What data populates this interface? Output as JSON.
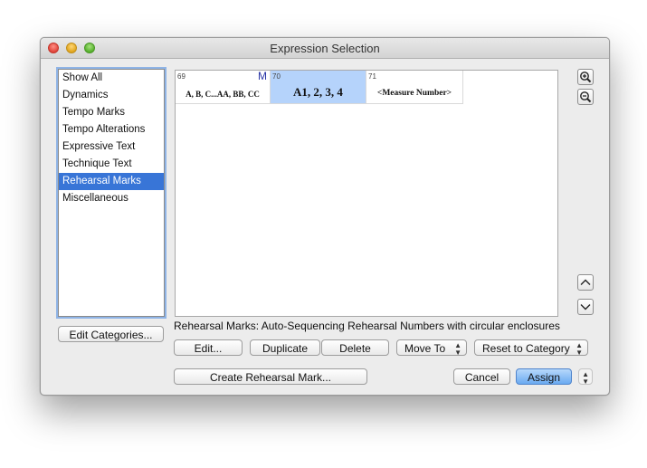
{
  "window": {
    "title": "Expression Selection"
  },
  "categories": {
    "items": [
      "Show All",
      "Dynamics",
      "Tempo Marks",
      "Tempo Alterations",
      "Expressive Text",
      "Technique Text",
      "Rehearsal Marks",
      "Miscellaneous"
    ],
    "selected": "Rehearsal Marks"
  },
  "buttons": {
    "edit_categories": "Edit Categories...",
    "edit": "Edit...",
    "duplicate": "Duplicate",
    "delete": "Delete",
    "move_to": "Move To",
    "reset_to_category": "Reset to Category",
    "create": "Create Rehearsal Mark...",
    "cancel": "Cancel",
    "assign": "Assign"
  },
  "palette": {
    "cells": [
      {
        "number": "69",
        "text": "A, B, C...AA, BB, CC",
        "marker": "M"
      },
      {
        "number": "70",
        "text": "A1, 2, 3, 4",
        "marker": ""
      },
      {
        "number": "71",
        "text": "<Measure Number>",
        "marker": ""
      }
    ],
    "selected_index": 1
  },
  "description": "Rehearsal Marks: Auto-Sequencing Rehearsal Numbers with circular enclosures",
  "colors": {
    "selection": "#3875d7",
    "cell_selection": "#b5d3fb",
    "default_button": "#6aaaf1"
  }
}
